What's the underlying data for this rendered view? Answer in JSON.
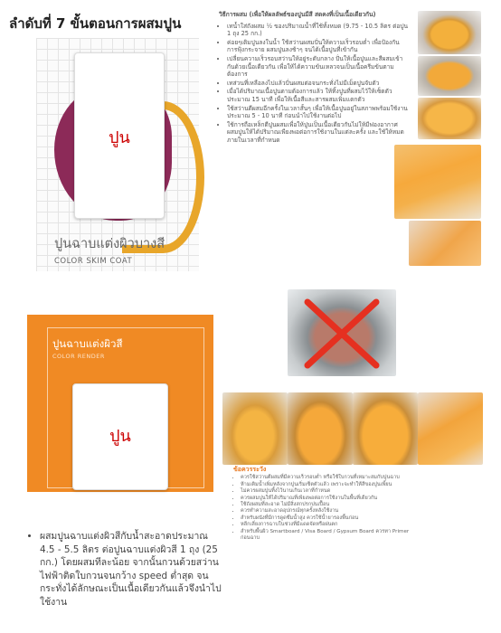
{
  "page": {
    "title": "ลำดับที่ 7 ขั้นตอนการผสมปูน"
  },
  "skim_coat": {
    "sack_label": "ปูน",
    "name_th": "ปูนฉาบแต่งผิวบางสี",
    "name_en": "COLOR SKIM COAT"
  },
  "render": {
    "name_th": "ปูนฉาบแต่งผิวสี",
    "name_en": "COLOR RENDER",
    "sack_label": "ปูน"
  },
  "steps": {
    "heading": "วิธีการผสม (เพื่อให้ผลลัพธ์ของปูนมีสี สดคงที่เป็นเนื้อเดียวกัน)",
    "items": [
      "เทน้ำใส่ถังผสม ½ ของปริมาณน้ำที่ใช้ทั้งหมด (9.75 - 10.5 ลิตร ต่อปูน 1 ถุง 25 กก.)",
      "ค่อยๆเติมปูนลงในน้ำ ใช้สว่านผสมปั่นให้ความเร็วรอบต่ำ เพื่อป้องกันการฟุ้งกระจาย ผสมปูนลงช้าๆ จนได้เนื้อปูนที่เข้ากัน",
      "เปลี่ยนความเร็วรอบสว่านให้อยู่ระดับกลาง ปั่นให้เนื้อปูนและสีผสมเข้ากันด้วยเนื้อเดียวกัน เพื่อให้ได้ความข้นเหลวจนเป็นเนื้อครีมข้นตามต้องการ",
      "เทส่วนที่เหลือลงไปแล้วปั่นผสมต่อจนกระทั่งไม่มีเม็ดปูนจับตัว",
      "เมื่อได้ปริมาณเนื้อปูนตามต้องการแล้ว ให้ทิ้งปูนที่ผสมไว้ให้เซ็ตตัวประมาณ 15 นาที เพื่อให้เนื้อสีและสารผสมเพิ่มแตกตัว",
      "ใช้สว่านตีผสมอีกครั้งในเวลาสั้นๆ เพื่อให้เนื้อปูนอยู่ในสภาพพร้อมใช้งาน ประมาณ 5 - 10 นาที ก่อนนำไปใช้งานต่อไป",
      "ใช้การถือเหล็กตีปูนผสมเพื่อให้ปูนเป็นเนื้อเดียวกันไม่ให้มีฟองอากาศ ผสมปูนให้ได้ปริมาณเพียงพอต่อการใช้งานในแต่ละครั้ง และใช้ให้หมดภายในเวลาที่กำหนด"
    ]
  },
  "caution": {
    "title": "ข้อควรระวัง",
    "items": [
      "ควรใช้สว่านตีผสมที่มีความเร็วรอบต่ำ หรือใช้ใบกวนที่เหมาะสมกับปูนฉาบ",
      "ห้ามเติมน้ำเพิ่มหลังจากปูนเริ่มเซ็ตตัวแล้ว เพราะจะทำให้สีของปูนเพี้ยน",
      "ไม่ควรผสมปูนทิ้งไว้นานเกินเวลาที่กำหนด",
      "ควรผสมปูนให้ได้ปริมาณที่เพียงพอต่อการใช้งานในพื้นที่เดียวกัน",
      "ใช้ถังผสมที่สะอาด ไม่มีสิ่งสกปรกปนเปื้อน",
      "ควรทำความสะอาดอุปกรณ์ทุกครั้งหลังใช้งาน",
      "สำหรับผนังที่มีการดูดซึมน้ำสูง ควรใช้น้ำยารองพื้นก่อน",
      "หลีกเลี่ยงการฉาบในช่วงที่มีแดดจัดหรือฝนตก",
      "สำหรับพื้นผิว Smartboard / Visa Board / Gypsum Board ควรทา Primer ก่อนฉาบ"
    ]
  },
  "bottom": {
    "text": "ผสมปูนฉาบแต่งผิวสีกับน้ำสะอาดประมาณ 4.5 - 5.5 ลิตร ต่อปูนฉาบแต่งผิวสี 1 ถุง (25 กก.) โดยผสมทีละน้อย จากนั้นกวนด้วยสว่านไฟฟ้าติดใบกวนจนกว้าง speed ต่ำสุด จนกระทั่งได้ลักษณะเป็นเนื้อเดียวกันแล้วจึงนำไปใช้งาน"
  },
  "colors": {
    "orange": "#f08a24",
    "purple": "#8c2a58",
    "mustard": "#e8a62a",
    "forbidden": "#e53020"
  }
}
